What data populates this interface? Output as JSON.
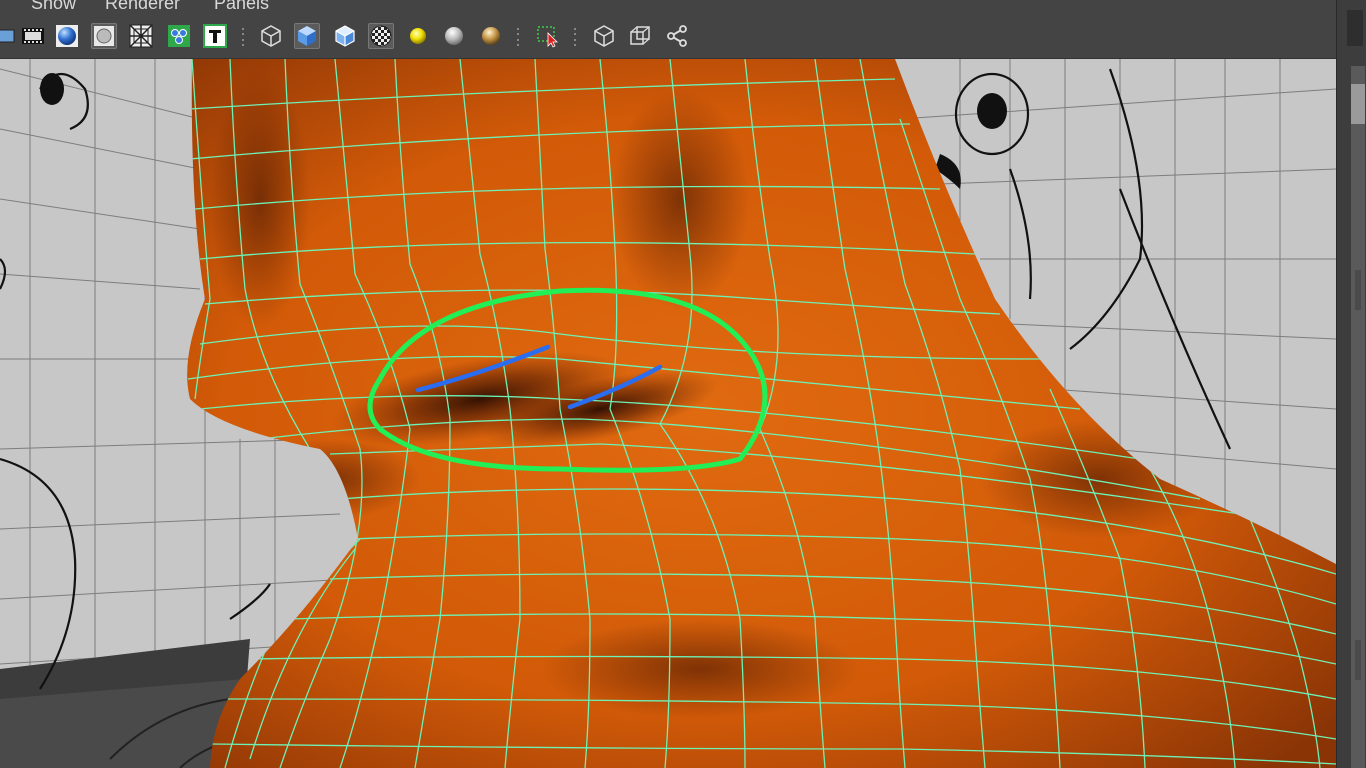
{
  "menubar": {
    "items": [
      {
        "label": "Show"
      },
      {
        "label": "Renderer"
      },
      {
        "label": "Panels"
      }
    ]
  },
  "toolbar": {
    "buttons": [
      {
        "icon": "film-gate-icon"
      },
      {
        "icon": "resolution-gate-icon"
      },
      {
        "icon": "shaded-sphere-icon"
      },
      {
        "icon": "wireframe-circle-icon"
      },
      {
        "icon": "grid-toggle-icon"
      },
      {
        "icon": "particles-icon"
      },
      {
        "icon": "text-icon"
      },
      {
        "icon": "wireframe-cube-icon"
      },
      {
        "icon": "smooth-shade-cube-icon"
      },
      {
        "icon": "wireframe-on-shaded-cube-icon"
      },
      {
        "icon": "checker-texture-icon"
      },
      {
        "icon": "default-light-icon"
      },
      {
        "icon": "all-lights-sphere-icon"
      },
      {
        "icon": "shadows-sphere-icon"
      },
      {
        "icon": "select-tool-icon"
      },
      {
        "icon": "isolate-select-cube-icon"
      },
      {
        "icon": "xray-cube-icon"
      },
      {
        "icon": "xray-joints-icon"
      }
    ]
  },
  "viewport": {
    "surface_color": "#d4600b",
    "wireframe_color": "#6ff0b4",
    "highlight_circle_color": "#22ee55",
    "selected_edge_color": "#2b6df0",
    "background_color": "#c7c7c7"
  }
}
